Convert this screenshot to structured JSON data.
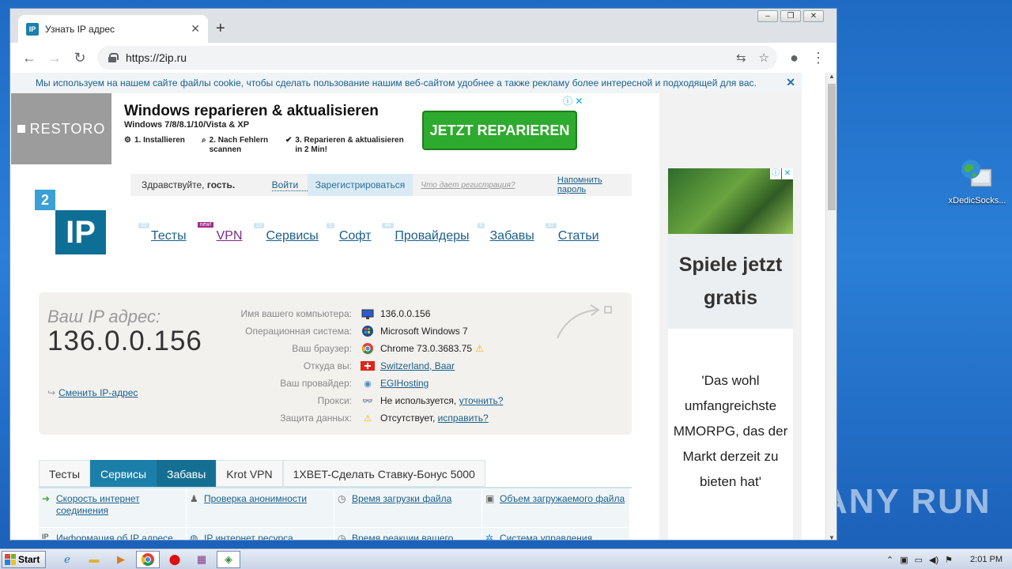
{
  "desktop": {
    "icon_label": "xDedicSocks...",
    "watermark": "ANY RUN"
  },
  "browser": {
    "tab_title": "Узнать IP адрес",
    "favicon": "IP",
    "url": "https://2ip.ru"
  },
  "cookie": {
    "text": "Мы используем на нашем сайте файлы cookie, чтобы сделать пользование нашим веб-сайтом удобнее а также рекламу более интересной и подходящей для вас."
  },
  "ad": {
    "logo": "RESTORO",
    "title": "Windows reparieren & aktualisieren",
    "subtitle": "Windows 7/8/8.1/10/Vista & XP",
    "steps": [
      "1. Installieren",
      "2. Nach Fehlern scannen",
      "3. Reparieren & aktualisieren in 2 Min!"
    ],
    "cta": "JETZT REPARIEREN"
  },
  "side_ad": {
    "headline": "Spiele jetzt gratis",
    "quote": "'Das wohl umfangreichste MMORPG, das der Markt derzeit zu bieten hat'"
  },
  "login": {
    "greeting": "Здравствуйте,",
    "guest": "гость.",
    "login": "Войти",
    "register": "Зарегистрироваться",
    "what_gives": "Что дает регистрация?",
    "remind": "Напомнить пароль"
  },
  "logo": {
    "top": "2",
    "main": "IP"
  },
  "nav": [
    {
      "label": "Тесты",
      "count": "32"
    },
    {
      "label": "VPN",
      "badge": "new!"
    },
    {
      "label": "Сервисы",
      "count": "15"
    },
    {
      "label": "Софт",
      "count": "5"
    },
    {
      "label": "Провайдеры",
      "count": "4K"
    },
    {
      "label": "Забавы",
      "count": "6"
    },
    {
      "label": "Статьи",
      "count": "37"
    }
  ],
  "ip": {
    "label": "Ваш IP адрес:",
    "value": "136.0.0.156",
    "change": "Сменить IP-адрес",
    "rows": [
      {
        "key": "Имя вашего компьютера:",
        "value": "136.0.0.156"
      },
      {
        "key": "Операционная система:",
        "value": "Microsoft Windows 7"
      },
      {
        "key": "Ваш браузер:",
        "value": "Chrome 73.0.3683.75"
      },
      {
        "key": "Откуда вы:",
        "value": "Switzerland, Baar"
      },
      {
        "key": "Ваш провайдер:",
        "value": "EGIHosting"
      },
      {
        "key": "Прокси:",
        "value": "Не используется,",
        "link": "уточнить?"
      },
      {
        "key": "Защита данных:",
        "value": "Отсутствует,",
        "link": "исправить?"
      }
    ]
  },
  "tabs": [
    "Тесты",
    "Сервисы",
    "Забавы",
    "Krot VPN",
    "1XBET-Сделать Ставку-Бонус 5000"
  ],
  "links": [
    [
      "Скорость интернет соединения",
      "Проверка анонимности",
      "Время загрузки файла",
      "Объем загружаемого файла"
    ],
    [
      "Информация об IP адресе",
      "IP интернет ресурса",
      "Время реакции вашего",
      "Система управления"
    ]
  ],
  "taskbar": {
    "start": "Start",
    "clock": "2:01 PM"
  }
}
